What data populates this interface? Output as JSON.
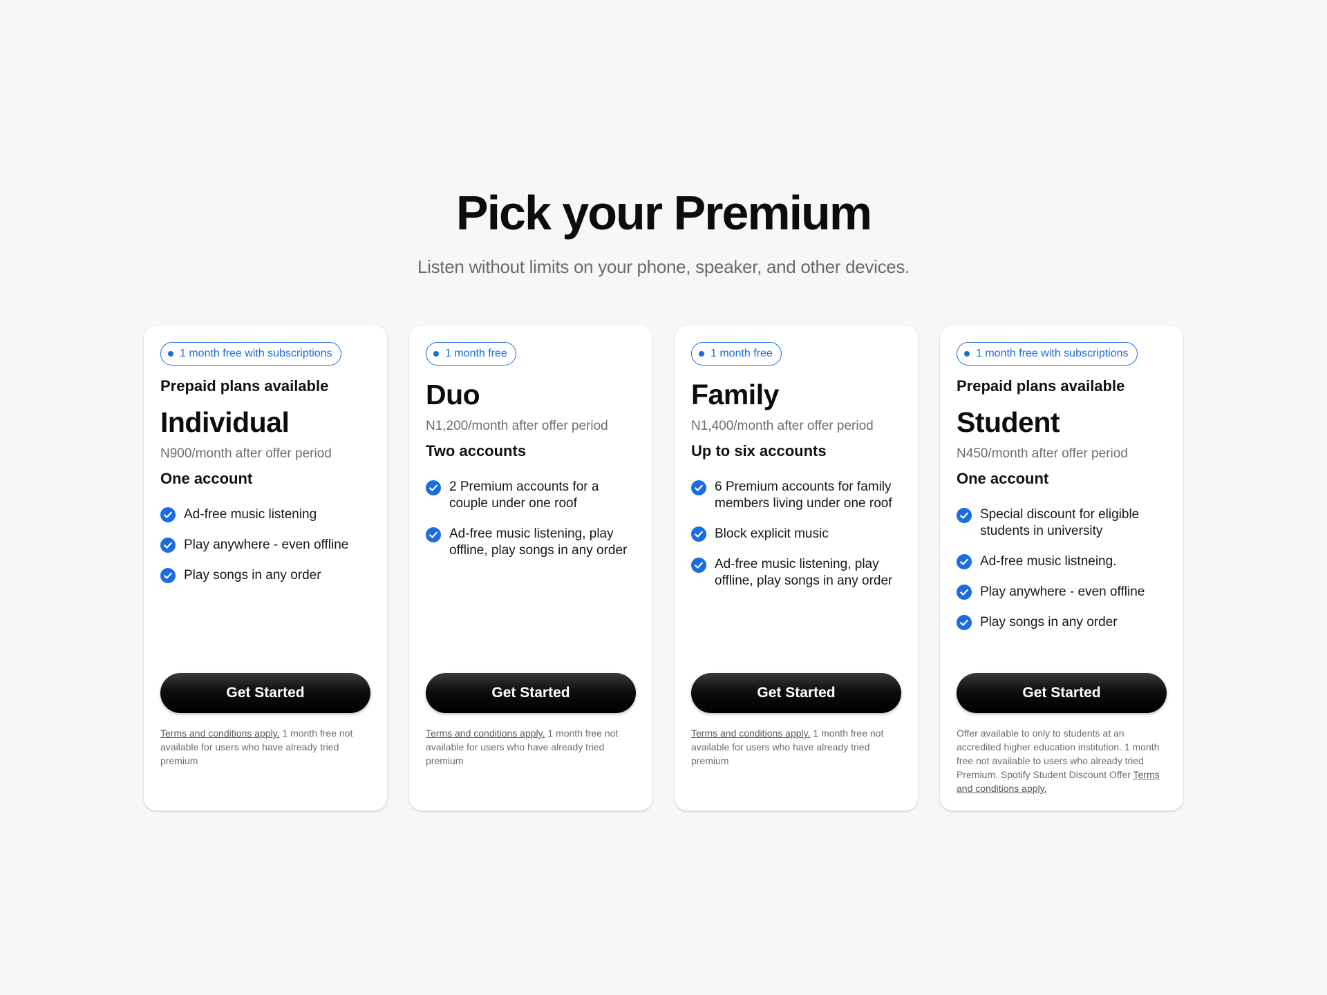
{
  "page": {
    "title": "Pick your Premium",
    "subtitle": "Listen without limits on your phone, speaker, and other devices."
  },
  "colors": {
    "accent": "#1a6ce0",
    "background": "#f7f7f7",
    "card": "#ffffff",
    "button": "#000000"
  },
  "plans": [
    {
      "badge": "1 month free with subscriptions",
      "prepaid": "Prepaid plans available",
      "name": "Individual",
      "price": "N900/month after offer period",
      "accounts": "One account",
      "features": [
        "Ad-free music listening",
        "Play anywhere - even offline",
        "Play songs in any order"
      ],
      "cta": "Get Started",
      "terms_link": "Terms and conditions apply.",
      "terms_text": " 1 month free not available for users who have already tried premium"
    },
    {
      "badge": "1 month free",
      "name": "Duo",
      "price": "N1,200/month after offer period",
      "accounts": "Two accounts",
      "features": [
        "2 Premium accounts for a couple under one roof",
        "Ad-free music listening, play offline, play songs in any order"
      ],
      "cta": "Get Started",
      "terms_link": "Terms and conditions apply.",
      "terms_text": " 1 month free not available for users who have already tried premium"
    },
    {
      "badge": "1 month free",
      "name": "Family",
      "price": "N1,400/month after offer period",
      "accounts": "Up to six accounts",
      "features": [
        "6 Premium accounts for family members living under one roof",
        "Block explicit music",
        "Ad-free music listening, play offline, play songs in any order"
      ],
      "cta": "Get Started",
      "terms_link": "Terms and conditions apply.",
      "terms_text": " 1 month free not available for users who have already tried premium"
    },
    {
      "badge": "1 month free with subscriptions",
      "prepaid": "Prepaid plans available",
      "name": "Student",
      "price": "N450/month after offer period",
      "accounts": "One account",
      "features": [
        "Special discount for eligible students in university",
        "Ad-free music listneing.",
        "Play anywhere - even offline",
        "Play songs in any order"
      ],
      "cta": "Get Started",
      "terms_pre": "Offer available to only to students at an accredited higher education institution. 1 month free not available to users who already tried Premium. Spotify Student Discount Offer ",
      "terms_link": "Terms and conditions apply."
    }
  ]
}
